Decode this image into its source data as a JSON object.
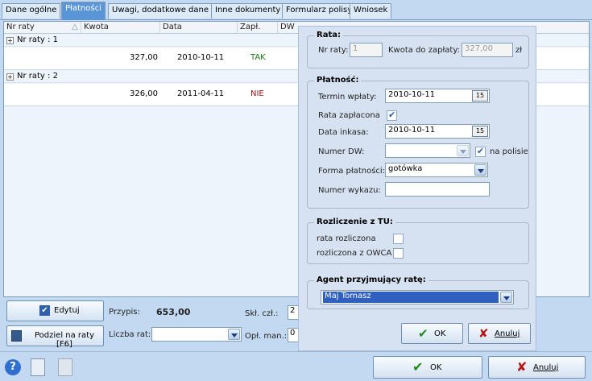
{
  "tabs": [
    "Dane ogólne",
    "Płatności",
    "Uwagi, dodatkowe dane",
    "Inne dokumenty",
    "Formularz polisy",
    "Wniosek"
  ],
  "grid": {
    "headers": [
      "Nr raty",
      "Kwota",
      "Data",
      "Zapł.",
      "DW"
    ],
    "groups": [
      {
        "label": "Nr raty : 1",
        "kwota": "327,00",
        "data": "2010-10-11",
        "zapl": "TAK"
      },
      {
        "label": "Nr raty : 2",
        "kwota": "326,00",
        "data": "2011-04-11",
        "zapl": "NIE"
      }
    ]
  },
  "bottom": {
    "edit_label": "Edytuj",
    "split_label": "Podziel na raty [F6]",
    "przypis_label": "Przypis:",
    "przypis_value": "653,00",
    "liczba_rat_label": "Liczba rat:",
    "skl_label": "Skł. czł.:",
    "skl_value": "2",
    "opl_label": "Opł. man.:",
    "opl_value": "0"
  },
  "footer": {
    "ok_label": "OK",
    "cancel_label": "Anuluj"
  },
  "popup": {
    "rata_title": "Rata:",
    "nr_raty_label": "Nr raty:",
    "nr_raty_value": "1",
    "kwota_label": "Kwota do zapłaty:",
    "kwota_value": "327,00",
    "kwota_unit": "zł",
    "platnosc_title": "Płatność:",
    "termin_label": "Termin wpłaty:",
    "termin_value": "2010-10-11",
    "rata_zaplacona_label": "Rata zapłacona",
    "data_inkasa_label": "Data inkasa:",
    "data_inkasa_value": "2010-10-11",
    "numer_dw_label": "Numer DW:",
    "na_polisie_label": "na polisie",
    "forma_label": "Forma płatności:",
    "forma_value": "gotówka",
    "numer_wykazu_label": "Numer wykazu:",
    "rozliczenie_title": "Rozliczenie z TU:",
    "rata_rozliczona_label": "rata rozliczona",
    "rozliczona_owca_label": "rozliczona z OWCA",
    "agent_title": "Agent przyjmujący ratę:",
    "agent_value": "Maj Tomasz",
    "ok_label": "OK",
    "cancel_label": "Anuluj",
    "cal_icon": "15"
  }
}
